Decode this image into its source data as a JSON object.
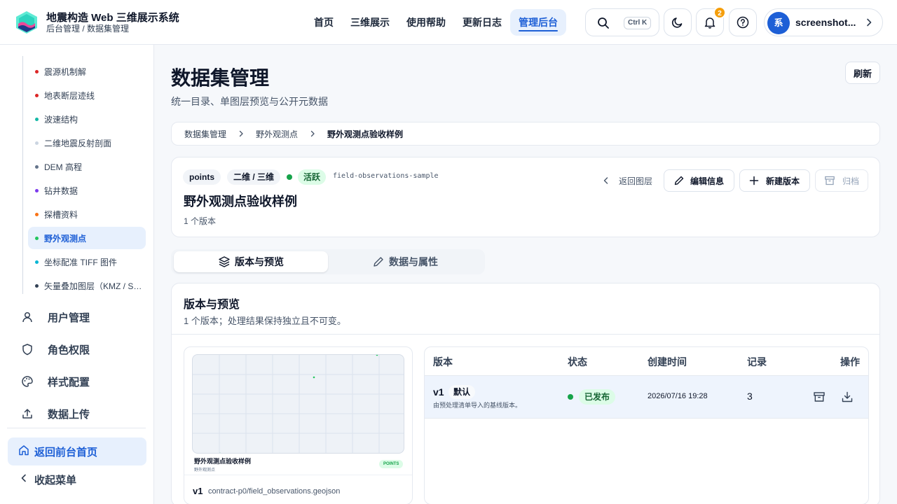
{
  "header": {
    "app_title": "地震构造 Web 三维展示系统",
    "app_subtitle": "后台管理 / 数据集管理",
    "nav": [
      "首页",
      "三维展示",
      "使用帮助",
      "更新日志",
      "管理后台"
    ],
    "active_nav": "管理后台",
    "search_shortcut": "Ctrl K",
    "notification_count": "2",
    "user": {
      "avatar_text": "系",
      "name": "screenshot..."
    }
  },
  "sidebar": {
    "sub_items": [
      {
        "label": "震源机制解",
        "color": "#dc2626"
      },
      {
        "label": "地表断层迹线",
        "color": "#dc2626"
      },
      {
        "label": "波速结构",
        "color": "#14b8a6"
      },
      {
        "label": "二维地震反射剖面",
        "color": "#cbd5e1"
      },
      {
        "label": "DEM 高程",
        "color": "#64748b"
      },
      {
        "label": "钻井数据",
        "color": "#7c3aed"
      },
      {
        "label": "探槽资料",
        "color": "#f97316"
      },
      {
        "label": "野外观测点",
        "color": "#22c55e",
        "active": true
      },
      {
        "label": "坐标配准 TIFF 图件",
        "color": "#06b6d4"
      },
      {
        "label": "矢量叠加图层（KMZ / Sh...",
        "color": "#334155"
      }
    ],
    "menu": [
      {
        "label": "用户管理",
        "icon": "user-icon"
      },
      {
        "label": "角色权限",
        "icon": "shield-icon"
      },
      {
        "label": "样式配置",
        "icon": "palette-icon"
      },
      {
        "label": "数据上传",
        "icon": "upload-icon"
      }
    ],
    "back_home": "返回前台首页",
    "collapse": "收起菜单"
  },
  "page": {
    "title": "数据集管理",
    "subtitle": "统一目录、单图层预览与公开元数据",
    "refresh": "刷新",
    "breadcrumb": [
      "数据集管理",
      "野外观测点",
      "野外观测点验收样例"
    ]
  },
  "dataset": {
    "tag_type": "points",
    "tag_dim": "二维 / 三维",
    "status": "活跃",
    "slug": "field-observations-sample",
    "name": "野外观测点验收样例",
    "version_count": "1 个版本",
    "actions": {
      "back": "返回图层",
      "edit": "编辑信息",
      "new_version": "新建版本",
      "archive": "归档"
    }
  },
  "tabs": [
    {
      "label": "版本与预览",
      "icon": "layers-icon"
    },
    {
      "label": "数据与属性",
      "icon": "pencil-icon"
    }
  ],
  "versions_panel": {
    "title": "版本与预览",
    "subtitle": "1 个版本；处理结果保持独立且不可变。",
    "preview": {
      "name": "野外观测点验收样例",
      "layer": "野外观测点",
      "pill": "POINTS",
      "version": "v1",
      "path": "contract-p0/field_observations.geojson"
    },
    "table": {
      "headers": [
        "版本",
        "状态",
        "创建时间",
        "记录",
        "操作"
      ],
      "rows": [
        {
          "version": "v1",
          "default_tag": "默认",
          "description": "由预处理清单导入的基线版本。",
          "status": "已发布",
          "created": "2026/07/16 19:28",
          "records": "3"
        }
      ]
    }
  }
}
